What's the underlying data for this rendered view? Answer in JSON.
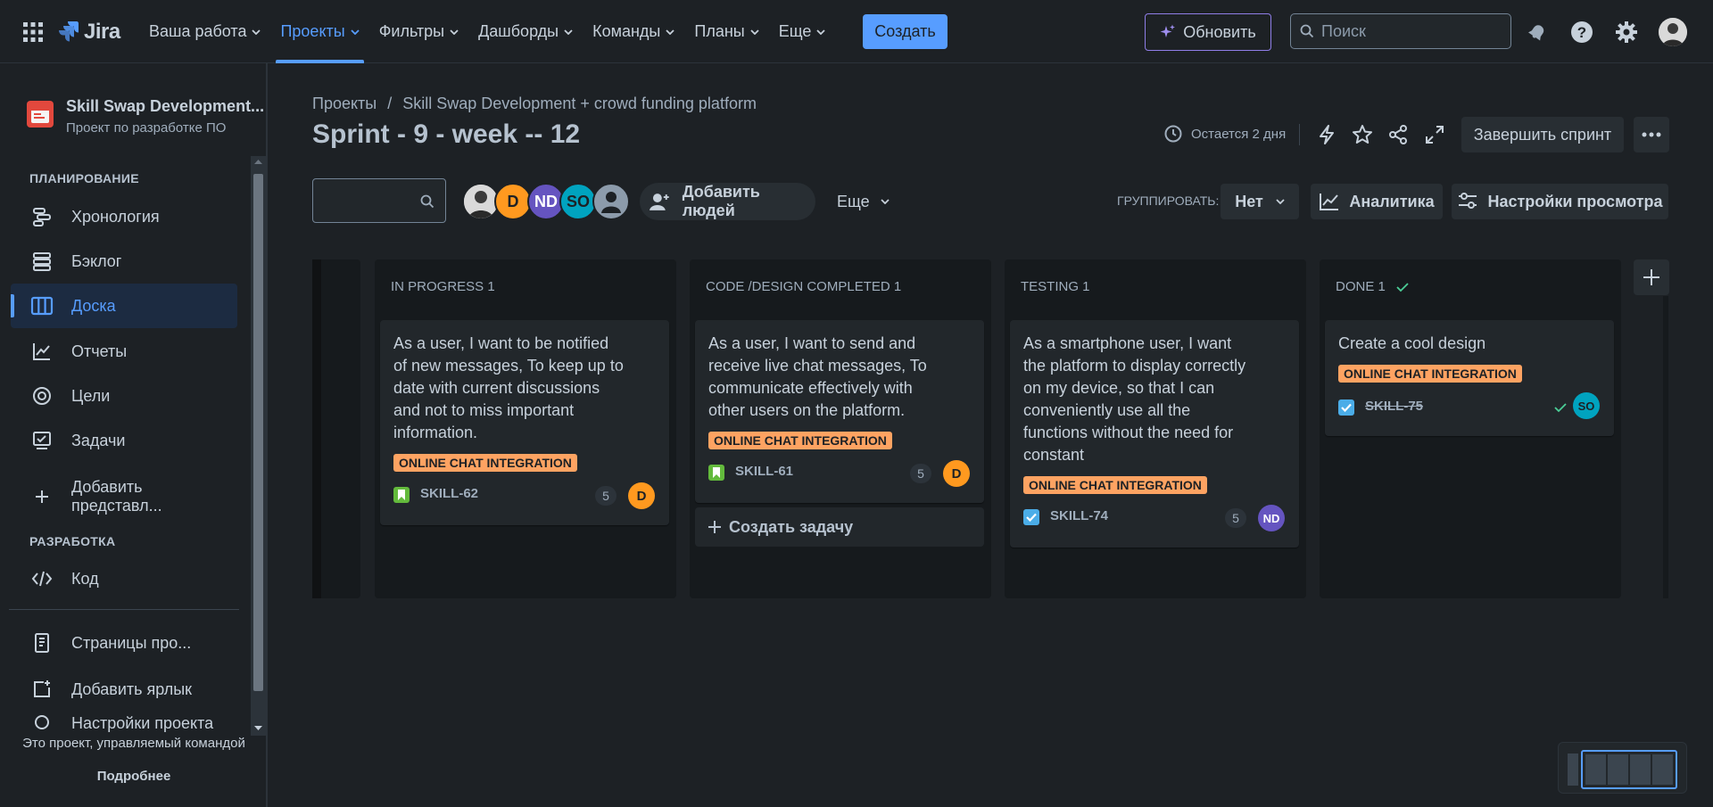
{
  "topnav": {
    "logo": "Jira",
    "menu": [
      {
        "label": "Ваша работа"
      },
      {
        "label": "Проекты"
      },
      {
        "label": "Фильтры"
      },
      {
        "label": "Дашборды"
      },
      {
        "label": "Команды"
      },
      {
        "label": "Планы"
      },
      {
        "label": "Еще"
      }
    ],
    "create_label": "Создать",
    "upgrade_label": "Обновить",
    "search_placeholder": "Поиск"
  },
  "sidebar": {
    "project_name": "Skill Swap Development...",
    "project_sub": "Проект по разработке ПО",
    "section_planning": "ПЛАНИРОВАНИЕ",
    "planning_items": [
      {
        "label": "Хронология",
        "icon": "timeline-icon"
      },
      {
        "label": "Бэклог",
        "icon": "backlog-icon"
      },
      {
        "label": "Доска",
        "icon": "board-icon"
      },
      {
        "label": "Отчеты",
        "icon": "reports-icon"
      },
      {
        "label": "Цели",
        "icon": "goals-icon"
      },
      {
        "label": "Задачи",
        "icon": "issues-icon"
      }
    ],
    "add_view": "Добавить представл...",
    "section_dev": "РАЗРАБОТКА",
    "code": "Код",
    "pages": "Страницы про...",
    "add_shortcut": "Добавить ярлык",
    "settings": "Настройки проекта",
    "footer_text": "Это проект, управляемый командой",
    "footer_more": "Подробнее"
  },
  "header": {
    "breadcrumb": [
      "Проекты",
      "/",
      "Skill Swap Development + crowd funding platform"
    ],
    "title": "Sprint - 9 - week -- 12",
    "remaining": "Остается 2 дня",
    "complete_sprint": "Завершить спринт"
  },
  "filters": {
    "avatars": [
      {
        "initials": "",
        "color": "#8a8f94"
      },
      {
        "initials": "D",
        "color": "#ff991f"
      },
      {
        "initials": "ND",
        "color": "#6554c0"
      },
      {
        "initials": "SO",
        "color": "#00a3bf"
      },
      {
        "initials": "",
        "color": "#8c9bab"
      }
    ],
    "add_people": "Добавить людей",
    "more": "Еще",
    "group_by_label": "ГРУППИРОВАТЬ:",
    "group_by_value": "Нет",
    "analytics": "Аналитика",
    "view_settings": "Настройки просмотра"
  },
  "board": {
    "columns": [
      {
        "title": "IN PROGRESS 1",
        "cards": [
          {
            "title": "As a user, I want to be notified of new messages, To keep up to date with current discussions and not to miss important information.",
            "label": "ONLINE CHAT INTEGRATION",
            "key": "SKILL-62",
            "points": "5",
            "assignee": "D",
            "type": "story"
          }
        ]
      },
      {
        "title": "CODE /DESIGN COMPLETED 1",
        "cards": [
          {
            "title": "As a user, I want to send and receive live chat messages, To communicate effectively with other users on the platform.",
            "label": "ONLINE CHAT INTEGRATION",
            "key": "SKILL-61",
            "points": "5",
            "assignee": "D",
            "type": "story"
          }
        ],
        "create_issue": "Создать задачу"
      },
      {
        "title": "TESTING 1",
        "cards": [
          {
            "title": "As a smartphone user, I want the platform to display correctly on my device, so that I can conveniently use all the functions without the need for constant",
            "label": "ONLINE CHAT INTEGRATION",
            "key": "SKILL-74",
            "points": "5",
            "assignee": "ND",
            "type": "task"
          }
        ]
      },
      {
        "title": "DONE 1",
        "cards": [
          {
            "title": "Create a cool design",
            "label": "ONLINE CHAT INTEGRATION",
            "key": "SKILL-75",
            "points": "",
            "assignee": "SO",
            "type": "task"
          }
        ]
      }
    ]
  },
  "colors": {
    "accent": "#579dff",
    "label_bg": "#fea362",
    "story": "#63ba3c",
    "task": "#4bade8",
    "avatar_d": "#ff991f",
    "avatar_nd": "#6554c0",
    "avatar_so": "#00a3bf"
  }
}
